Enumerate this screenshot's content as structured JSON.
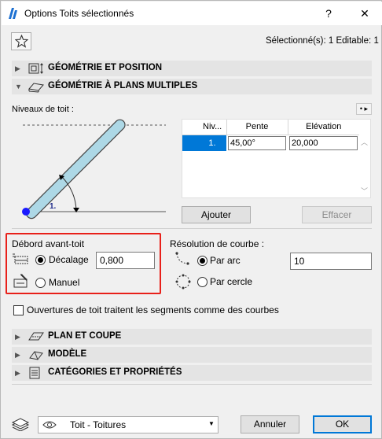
{
  "window": {
    "title": "Options Toits sélectionnés",
    "help_label": "?",
    "close_label": "✕"
  },
  "header": {
    "selection_info": "Sélectionné(s): 1 Editable: 1"
  },
  "sections": {
    "geometry_position": "GÉOMÉTRIE ET POSITION",
    "multi_plane": "GÉOMÉTRIE À PLANS MULTIPLES",
    "plan_section": "PLAN ET COUPE",
    "model": "MODÈLE",
    "categories": "CATÉGORIES ET PROPRIÉTÉS"
  },
  "roof_levels": {
    "label": "Niveaux de toit :",
    "diagram_level_label": "1.",
    "columns": [
      "Niv...",
      "Pente",
      "Elévation"
    ],
    "rows": [
      {
        "level": "1.",
        "pitch": "45,00°",
        "elevation": "20,000"
      }
    ],
    "add_button": "Ajouter",
    "delete_button": "Effacer"
  },
  "eaves_overhang": {
    "title": "Débord avant-toit",
    "offset_label": "Décalage",
    "offset_value": "0,800",
    "manual_label": "Manuel",
    "selected": "offset"
  },
  "curve_resolution": {
    "title": "Résolution de courbe :",
    "by_arc_label": "Par arc",
    "by_arc_value": "10",
    "by_circle_label": "Par cercle",
    "selected": "arc"
  },
  "roof_openings_checkbox": {
    "label": "Ouvertures de toit traitent les segments comme des courbes",
    "checked": false
  },
  "footer": {
    "layer_value": "Toit - Toitures",
    "cancel_button": "Annuler",
    "ok_button": "OK"
  },
  "colors": {
    "accent": "#0078d7",
    "highlight_frame": "#e8201a",
    "roof_fill": "#add8e6",
    "pivot_dot": "#1a1aff"
  }
}
